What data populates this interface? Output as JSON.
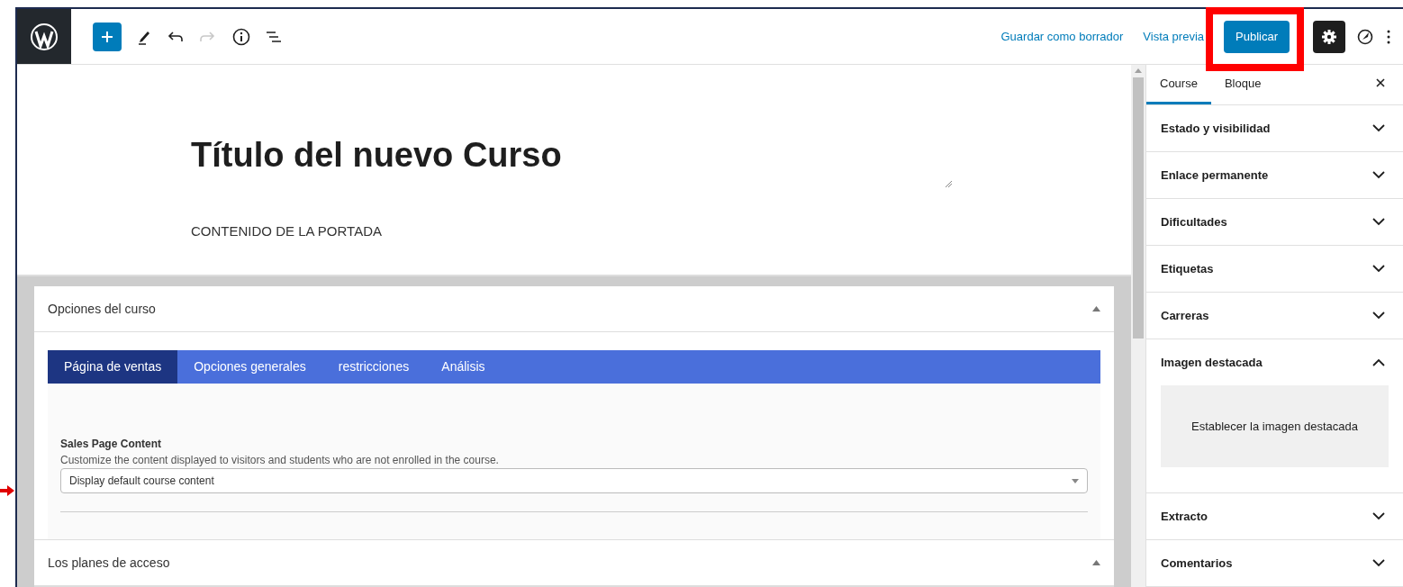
{
  "toolbar": {
    "actions": [
      {
        "kind": "link",
        "label": "Guardar como borrador"
      },
      {
        "kind": "link",
        "label": "Vista previa"
      },
      {
        "kind": "primary",
        "label": "Publicar",
        "highlighted": true
      }
    ]
  },
  "editor": {
    "title": "Título del nuevo Curso",
    "content": "CONTENIDO DE LA PORTADA",
    "metaboxes": [
      {
        "title": "Opciones del curso",
        "expanded": true,
        "tabs": [
          {
            "label": "Página de ventas",
            "selected": true
          },
          {
            "label": "Opciones generales",
            "selected": false
          },
          {
            "label": "restricciones",
            "selected": false
          },
          {
            "label": "Análisis",
            "selected": false
          }
        ],
        "field": {
          "label": "Sales Page Content",
          "description": "Customize the content displayed to visitors and students who are not enrolled in the course.",
          "value": "Display default course content"
        }
      },
      {
        "title": "Los planes de acceso",
        "expanded": true
      }
    ]
  },
  "sidebar": {
    "tabs": [
      {
        "label": "Course",
        "selected": true
      },
      {
        "label": "Bloque",
        "selected": false
      }
    ],
    "panels": [
      {
        "title": "Estado y visibilidad",
        "expanded": false
      },
      {
        "title": "Enlace permanente",
        "expanded": false
      },
      {
        "title": "Dificultades",
        "expanded": false
      },
      {
        "title": "Etiquetas",
        "expanded": false
      },
      {
        "title": "Carreras",
        "expanded": false
      },
      {
        "title": "Imagen destacada",
        "expanded": true,
        "button": "Establecer la imagen destacada"
      },
      {
        "title": "Extracto",
        "expanded": false
      },
      {
        "title": "Comentarios",
        "expanded": false
      }
    ]
  }
}
